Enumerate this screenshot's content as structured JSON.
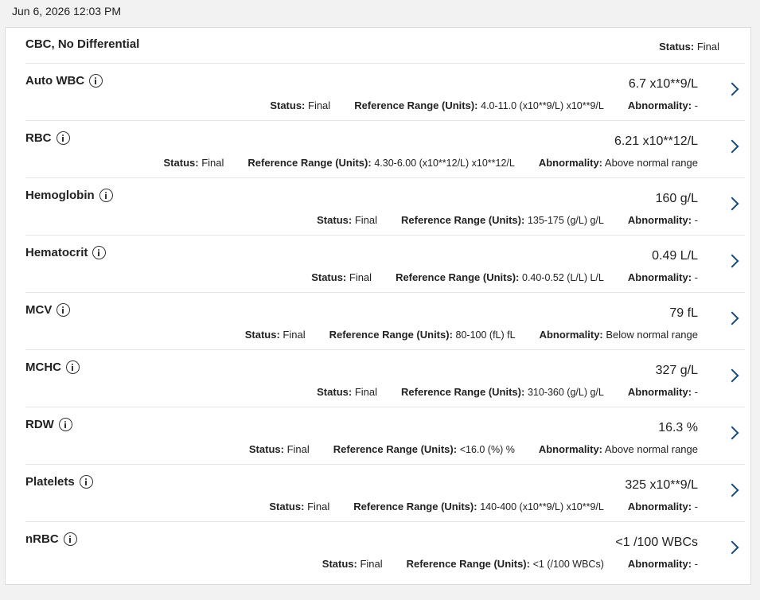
{
  "timestamp": "Jun 6, 2026 12:03 PM",
  "panel": {
    "title": "CBC, No Differential",
    "status_label": "Status:",
    "status": "Final"
  },
  "labels": {
    "status": "Status:",
    "reference_range": "Reference Range (Units):",
    "abnormality": "Abnormality:"
  },
  "results": [
    {
      "name": "Auto WBC",
      "value": "6.7 x10**9/L",
      "status": "Final",
      "reference_range": "4.0-11.0 (x10**9/L) x10**9/L",
      "abnormality": "-"
    },
    {
      "name": "RBC",
      "value": "6.21 x10**12/L",
      "status": "Final",
      "reference_range": "4.30-6.00 (x10**12/L) x10**12/L",
      "abnormality": "Above normal range"
    },
    {
      "name": "Hemoglobin",
      "value": "160 g/L",
      "status": "Final",
      "reference_range": "135-175 (g/L) g/L",
      "abnormality": "-"
    },
    {
      "name": "Hematocrit",
      "value": "0.49 L/L",
      "status": "Final",
      "reference_range": "0.40-0.52 (L/L) L/L",
      "abnormality": "-"
    },
    {
      "name": "MCV",
      "value": "79 fL",
      "status": "Final",
      "reference_range": "80-100 (fL) fL",
      "abnormality": "Below normal range"
    },
    {
      "name": "MCHC",
      "value": "327 g/L",
      "status": "Final",
      "reference_range": "310-360 (g/L) g/L",
      "abnormality": "-"
    },
    {
      "name": "RDW",
      "value": "16.3 %",
      "status": "Final",
      "reference_range": "<16.0 (%) %",
      "abnormality": "Above normal range"
    },
    {
      "name": "Platelets",
      "value": "325 x10**9/L",
      "status": "Final",
      "reference_range": "140-400 (x10**9/L) x10**9/L",
      "abnormality": "-"
    },
    {
      "name": "nRBC",
      "value": "<1 /100 WBCs",
      "status": "Final",
      "reference_range": "<1 (/100 WBCs)",
      "abnormality": "-"
    }
  ],
  "icons": {
    "info": "info-circle-icon",
    "chevron": "chevron-right-icon"
  },
  "colors": {
    "chevron": "#1a4a7a",
    "divider": "#e6e6e6",
    "background": "#f2f2f2"
  }
}
